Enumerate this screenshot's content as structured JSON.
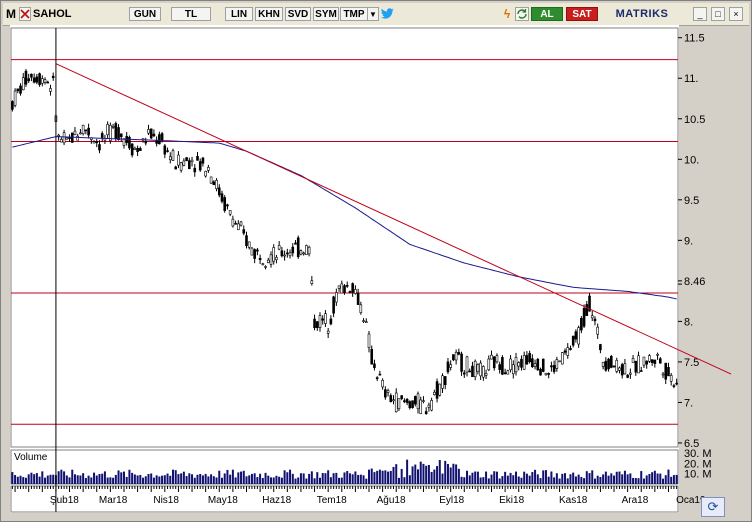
{
  "toolbar": {
    "app_letter": "M",
    "symbol": "SAHOL",
    "buttons": [
      "GUN",
      "TL",
      "LIN",
      "KHN",
      "SVD",
      "SYM",
      "TMP"
    ],
    "dropdown_glyph": "▼",
    "al_label": "AL",
    "sat_label": "SAT",
    "brand": "MATRIKS",
    "win_min": "_",
    "win_max": "□",
    "win_close": "×"
  },
  "colors": {
    "candle": "#000000",
    "moving_average": "#1a1a8c",
    "trendline": "#c0001a",
    "horizontal_lines": "#c0001a",
    "volume": "#101070",
    "cursor_line": "#000000"
  },
  "chart_data": {
    "type": "candlestick",
    "symbol": "SAHOL",
    "price_axis": {
      "ticks": [
        11.5,
        11,
        10.5,
        10,
        9.5,
        9,
        8.5,
        8,
        7.5,
        7,
        6.5
      ],
      "tick_labels": [
        "11.5",
        "11.",
        "10.5",
        "10.",
        "9.5",
        "9.",
        "8.46",
        "8.",
        "7.5",
        "7.",
        "6.5"
      ],
      "last_price_label": "8.46",
      "ylim": [
        6.45,
        11.62
      ]
    },
    "x_axis": {
      "labels": [
        "Şub18",
        "Mar18",
        "Nis18",
        "May18",
        "Haz18",
        "Tem18",
        "Ağu18",
        "Eyl18",
        "Eki18",
        "Kas18",
        "Ara18",
        "Oca19"
      ],
      "display": [
        "Şub18",
        "Mar18",
        "Nis18",
        "May18",
        "Haz18",
        "Tem18",
        "Ağu18",
        "Eyl18",
        "Eki18",
        "Kas18",
        "Ara18",
        "Oca19"
      ],
      "label_session_index": [
        0,
        18,
        38,
        58,
        78,
        98,
        120,
        143,
        165,
        187,
        210,
        230
      ]
    },
    "horizontal_lines": [
      11.23,
      10.22,
      8.35,
      6.73
    ],
    "trendline": {
      "start": [
        0,
        11.18
      ],
      "end": [
        248,
        7.35
      ]
    },
    "series_keyframes": [
      [
        -16,
        10.7
      ],
      [
        -10,
        11.05
      ],
      [
        -4,
        11.0
      ],
      [
        -1,
        10.9
      ],
      [
        1,
        10.25
      ],
      [
        4,
        10.2
      ],
      [
        10,
        10.4
      ],
      [
        16,
        10.2
      ],
      [
        22,
        10.38
      ],
      [
        30,
        10.1
      ],
      [
        34,
        10.3
      ],
      [
        38,
        10.25
      ],
      [
        44,
        9.95
      ],
      [
        50,
        10.0
      ],
      [
        56,
        9.9
      ],
      [
        62,
        9.45
      ],
      [
        67,
        9.15
      ],
      [
        73,
        8.85
      ],
      [
        80,
        8.8
      ],
      [
        87,
        8.9
      ],
      [
        93,
        8.9
      ],
      [
        95,
        8.0
      ],
      [
        100,
        8.0
      ],
      [
        104,
        8.4
      ],
      [
        109,
        8.45
      ],
      [
        113,
        8.1
      ],
      [
        116,
        7.55
      ],
      [
        121,
        7.1
      ],
      [
        126,
        7.0
      ],
      [
        131,
        7.0
      ],
      [
        136,
        6.95
      ],
      [
        141,
        7.2
      ],
      [
        146,
        7.55
      ],
      [
        151,
        7.45
      ],
      [
        156,
        7.35
      ],
      [
        161,
        7.5
      ],
      [
        166,
        7.45
      ],
      [
        171,
        7.5
      ],
      [
        176,
        7.55
      ],
      [
        181,
        7.35
      ],
      [
        186,
        7.55
      ],
      [
        191,
        7.75
      ],
      [
        196,
        8.25
      ],
      [
        201,
        7.55
      ],
      [
        206,
        7.45
      ],
      [
        211,
        7.4
      ],
      [
        216,
        7.5
      ],
      [
        221,
        7.55
      ],
      [
        226,
        7.3
      ],
      [
        231,
        7.25
      ],
      [
        236,
        7.25
      ],
      [
        239,
        7.4
      ],
      [
        241,
        7.95
      ],
      [
        242,
        8.2
      ],
      [
        244,
        8.46
      ]
    ],
    "moving_average_keyframes": [
      [
        -16,
        10.15
      ],
      [
        0,
        10.28
      ],
      [
        40,
        10.23
      ],
      [
        60,
        10.2
      ],
      [
        70,
        10.1
      ],
      [
        90,
        9.8
      ],
      [
        110,
        9.4
      ],
      [
        130,
        8.95
      ],
      [
        150,
        8.72
      ],
      [
        170,
        8.55
      ],
      [
        190,
        8.42
      ],
      [
        210,
        8.37
      ],
      [
        225,
        8.3
      ],
      [
        244,
        8.15
      ]
    ],
    "volume_axis": {
      "tick_labels": [
        "30. M",
        "20. M",
        "10. M"
      ],
      "ticks": [
        30,
        20,
        10
      ],
      "ylim": [
        0,
        33
      ]
    },
    "volume_title": "Volume",
    "session_count": 245,
    "pre_sessions": 16
  }
}
